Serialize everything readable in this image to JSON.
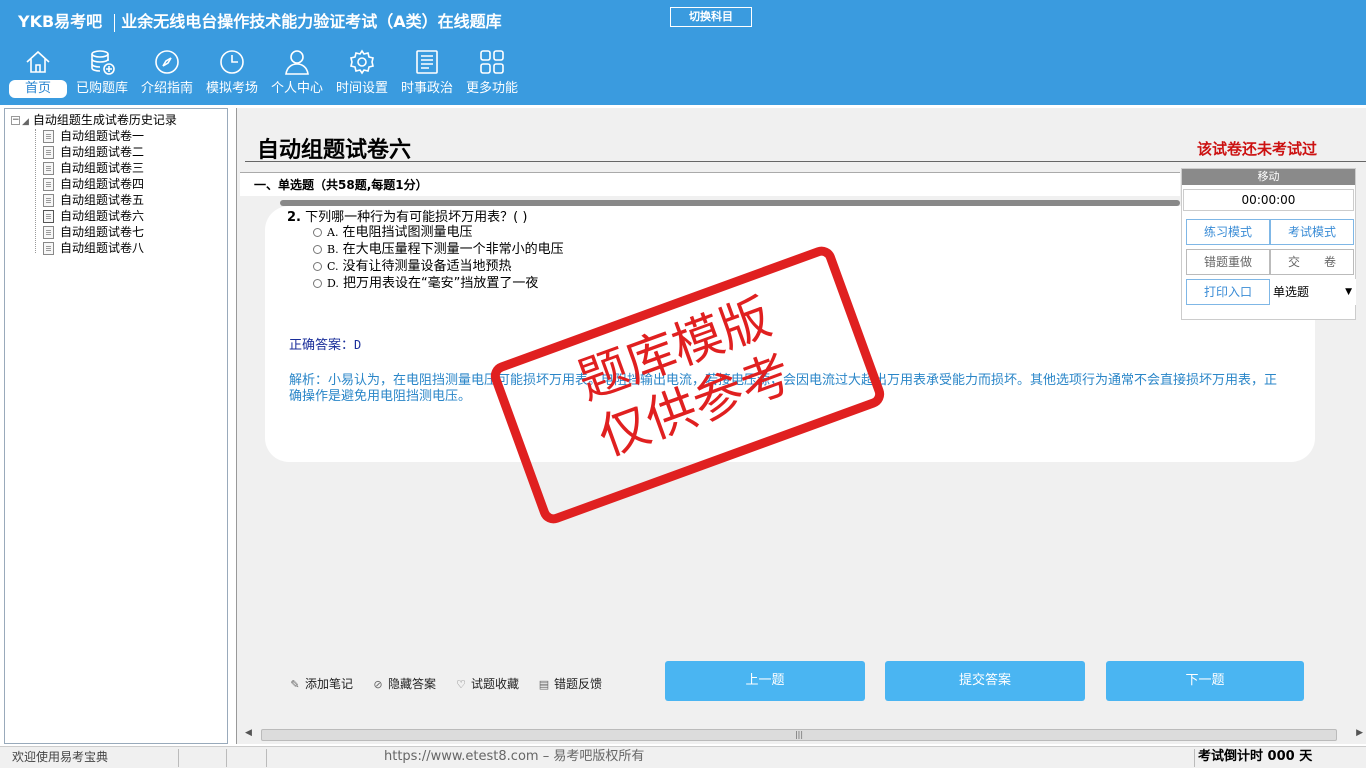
{
  "header": {
    "brand": "YKB易考吧",
    "app_title": "业余无线电台操作技术能力验证考试（A类）在线题库",
    "switch_subject": "切换科目",
    "nav": [
      {
        "label": "首页",
        "icon": "home-icon"
      },
      {
        "label": "已购题库",
        "icon": "database-icon"
      },
      {
        "label": "介绍指南",
        "icon": "compass-icon"
      },
      {
        "label": "模拟考场",
        "icon": "clock-icon"
      },
      {
        "label": "个人中心",
        "icon": "user-icon"
      },
      {
        "label": "时间设置",
        "icon": "gear-icon"
      },
      {
        "label": "时事政治",
        "icon": "newspaper-icon"
      },
      {
        "label": "更多功能",
        "icon": "grid-icon"
      }
    ]
  },
  "tree": {
    "root": "自动组题生成试卷历史记录",
    "items": [
      "自动组题试卷一",
      "自动组题试卷二",
      "自动组题试卷三",
      "自动组题试卷四",
      "自动组题试卷五",
      "自动组题试卷六",
      "自动组题试卷七",
      "自动组题试卷八"
    ]
  },
  "main": {
    "paper_title": "自动组题试卷六",
    "exam_status": "该试卷还未考试过",
    "section_header": "一、单选题（共58题,每题1分）",
    "question": {
      "number": "2.",
      "stem": "下列哪一种行为有可能损坏万用表？( )",
      "options": [
        {
          "letter": "A.",
          "text": "在电阻挡试图测量电压"
        },
        {
          "letter": "B.",
          "text": "在大电压量程下测量一个非常小的电压"
        },
        {
          "letter": "C.",
          "text": "没有让待测量设备适当地预热"
        },
        {
          "letter": "D.",
          "text": "把万用表设在“毫安”挡放置了一夜"
        }
      ],
      "answer_label": "正确答案：",
      "answer_value": "D",
      "analysis": "解析：小易认为，在电阻挡测量电压可能损坏万用表。电阻挡输出电流，若接电压源，会因电流过大超出万用表承受能力而损坏。其他选项行为通常不会直接损坏万用表，正确操作是避免用电阻挡测电压。"
    }
  },
  "panel": {
    "move": "移动",
    "timer": "00:00:00",
    "practice_mode": "练习模式",
    "exam_mode": "考试模式",
    "redo_wrong": "错题重做",
    "submit_paper": "交　　卷",
    "print_entry": "打印入口",
    "question_type": "单选题"
  },
  "tools": {
    "add_note": "添加笔记",
    "hide_answer": "隐藏答案",
    "favorite": "试题收藏",
    "report_error": "错题反馈",
    "prev": "上一题",
    "submit_answer": "提交答案",
    "next": "下一题"
  },
  "stamp": {
    "line1": "题库模版",
    "line2": "仅供参考"
  },
  "status": {
    "welcome": "欢迎使用易考宝典",
    "url": "https://www.etest8.com – 易考吧版权所有",
    "countdown": "考试倒计时 000 天"
  },
  "colors": {
    "header_bg": "#3a9bdf",
    "button_blue": "#4ab5f2",
    "status_red": "#cc1111",
    "stamp_red": "#e02020",
    "analysis_blue": "#2a86c8"
  }
}
